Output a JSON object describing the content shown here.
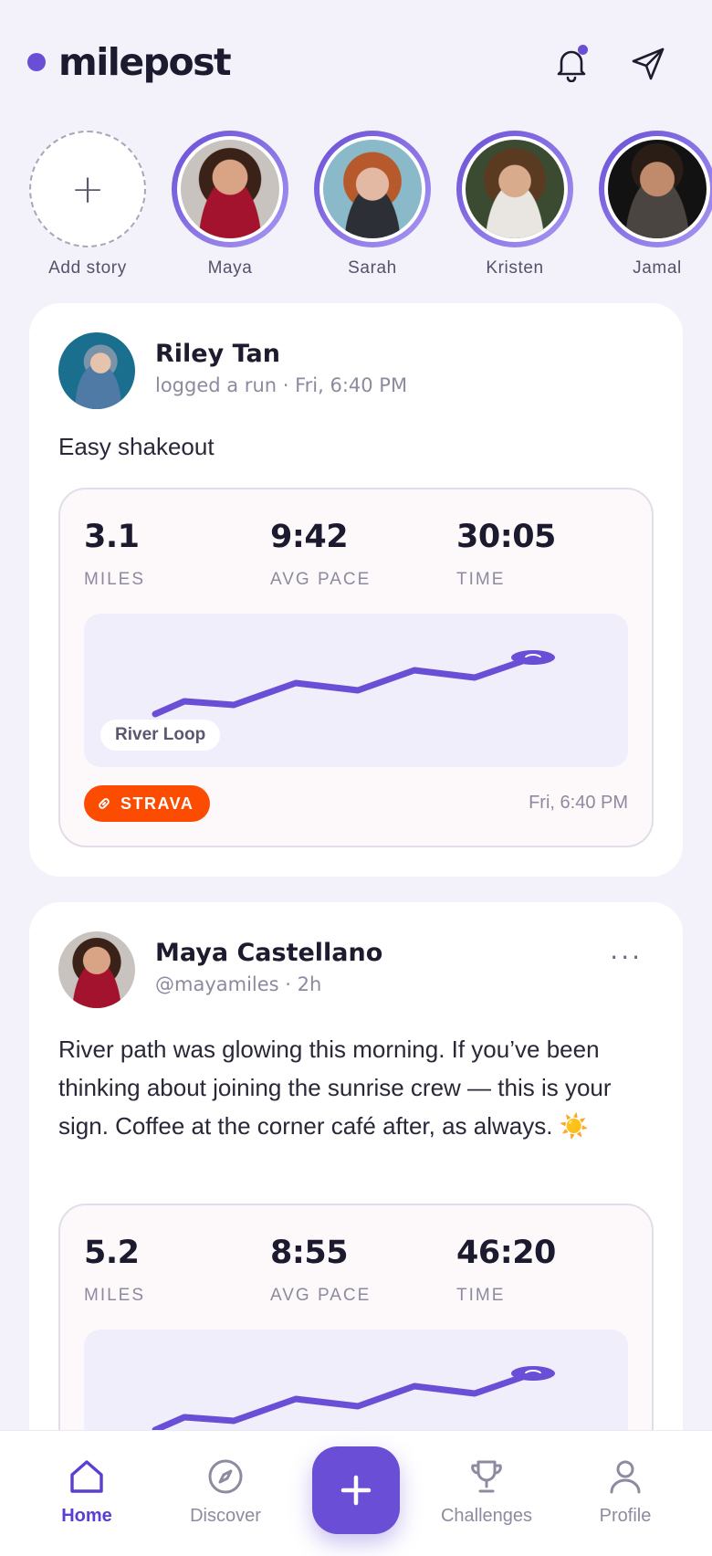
{
  "app": {
    "brand": "milepost"
  },
  "stories": [
    {
      "name": "Add story",
      "type": "add"
    },
    {
      "name": "Maya"
    },
    {
      "name": "Sarah"
    },
    {
      "name": "Kristen"
    },
    {
      "name": "Jamal"
    }
  ],
  "posts": [
    {
      "author": "Riley Tan",
      "meta": "logged a run · Fri, 6:40 PM",
      "text": "Easy shakeout",
      "activity": {
        "stats": [
          {
            "value": "3.1",
            "label": "MILES"
          },
          {
            "value": "9:42",
            "label": "AVG PACE"
          },
          {
            "value": "30:05",
            "label": "TIME"
          }
        ],
        "route_label": "River Loop",
        "source": "STRAVA",
        "time": "Fri, 6:40 PM"
      }
    },
    {
      "author": "Maya Castellano",
      "meta": "@mayamiles · 2h",
      "more": "···",
      "text": "River path was glowing this morning. If you’ve been thinking about joining the sunrise crew — this is your sign. Coffee at the corner café after, as always. ☀️",
      "activity": {
        "stats": [
          {
            "value": "5.2",
            "label": "MILES"
          },
          {
            "value": "8:55",
            "label": "AVG PACE"
          },
          {
            "value": "46:20",
            "label": "TIME"
          }
        ]
      }
    }
  ],
  "nav": {
    "items": [
      {
        "label": "Home",
        "icon": "home-icon",
        "active": true
      },
      {
        "label": "Discover",
        "icon": "compass-icon"
      },
      {
        "label": "Challenges",
        "icon": "trophy-icon"
      },
      {
        "label": "Profile",
        "icon": "profile-icon"
      }
    ],
    "fab_icon": "plus-icon"
  },
  "colors": {
    "accent": "#6a4fd6",
    "strava": "#fc4c02",
    "background": "#f3f2fa"
  }
}
